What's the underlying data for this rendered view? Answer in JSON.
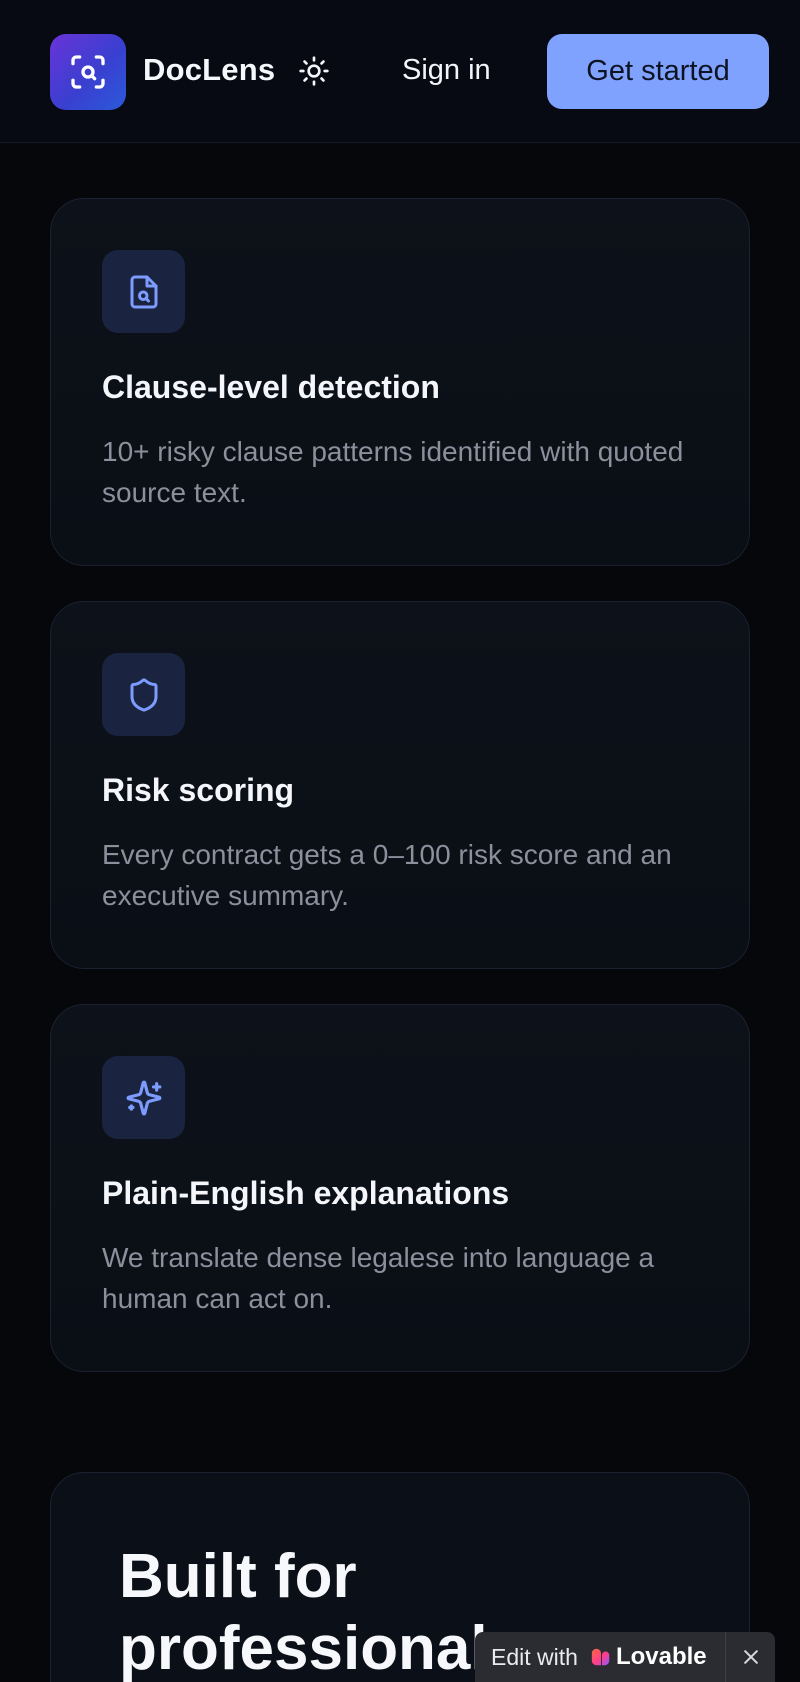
{
  "header": {
    "brand": "DocLens",
    "sign_in": "Sign in",
    "get_started": "Get started",
    "icons": {
      "logo": "scan-search-icon",
      "theme": "sun-icon"
    }
  },
  "features": [
    {
      "icon": "file-search-icon",
      "title": "Clause-level detection",
      "description": "10+ risky clause patterns identified with quoted source text."
    },
    {
      "icon": "shield-icon",
      "title": "Risk scoring",
      "description": "Every contract gets a 0–100 risk score and an executive summary."
    },
    {
      "icon": "sparkles-icon",
      "title": "Plain-English explanations",
      "description": "We translate dense legalese into language a human can act on."
    }
  ],
  "section": {
    "title": "Built for professional"
  },
  "badge": {
    "text": "Edit with",
    "brand": "Lovable"
  },
  "colors": {
    "background": "#05070b",
    "accent": "#7fa2ff",
    "icon_tile": "#1a2440",
    "icon_stroke": "#7d9cff",
    "muted_text": "#8a909c"
  }
}
